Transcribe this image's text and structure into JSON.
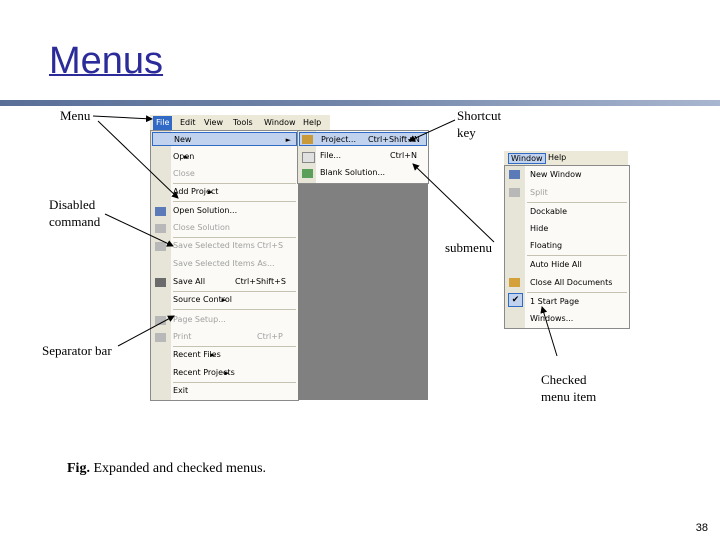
{
  "slide": {
    "title": "Menus",
    "caption_prefix": "Fig.",
    "caption_text": " Expanded and checked menus.",
    "page_number": "38"
  },
  "labels": {
    "menu": "Menu",
    "shortcut": "Shortcut\nkey",
    "disabled": "Disabled\ncommand",
    "submenu": "submenu",
    "separator": "Separator bar",
    "checked": "Checked\nmenu item"
  },
  "menubar": [
    "File",
    "Edit",
    "View",
    "Tools",
    "Window",
    "Help"
  ],
  "file_menu": [
    {
      "label": "New",
      "arrow": "►",
      "state": "selected"
    },
    {
      "label": "Open",
      "arrow": "►"
    },
    {
      "label": "Close",
      "state": "disabled"
    },
    {
      "label": "Add Project",
      "arrow": "►"
    },
    {
      "label": "Open Solution..."
    },
    {
      "label": "Close Solution",
      "state": "disabled"
    },
    {
      "label": "Save Selected Items",
      "shortcut": "Ctrl+S",
      "state": "disabled"
    },
    {
      "label": "Save Selected Items As...",
      "state": "disabled"
    },
    {
      "label": "Save All",
      "shortcut": "Ctrl+Shift+S"
    },
    {
      "label": "Source Control",
      "arrow": "►"
    },
    {
      "label": "Page Setup...",
      "state": "disabled"
    },
    {
      "label": "Print",
      "shortcut": "Ctrl+P",
      "state": "disabled"
    },
    {
      "label": "Recent Files",
      "arrow": "►"
    },
    {
      "label": "Recent Projects",
      "arrow": "►"
    },
    {
      "label": "Exit"
    }
  ],
  "new_submenu": [
    {
      "label": "Project...",
      "shortcut": "Ctrl+Shift+N",
      "state": "selected"
    },
    {
      "label": "File...",
      "shortcut": "Ctrl+N"
    },
    {
      "label": "Blank Solution..."
    }
  ],
  "window_menu": {
    "bar": [
      "Window",
      "Help"
    ],
    "items": [
      {
        "label": "New Window"
      },
      {
        "label": "Split",
        "state": "disabled"
      },
      {
        "label": "Dockable"
      },
      {
        "label": "Hide"
      },
      {
        "label": "Floating"
      },
      {
        "label": "Auto Hide All"
      },
      {
        "label": "Close All Documents"
      },
      {
        "label": "1 Start Page",
        "checked": "✔"
      },
      {
        "label": "Windows..."
      }
    ]
  }
}
